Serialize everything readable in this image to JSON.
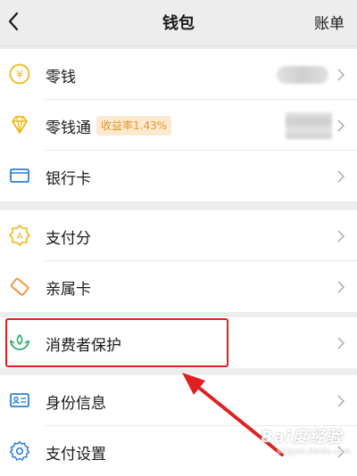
{
  "header": {
    "title": "钱包",
    "right_action": "账单"
  },
  "group1": {
    "items": [
      {
        "label": "零钱",
        "icon": "yen-coin-icon"
      },
      {
        "label": "零钱通",
        "badge": "收益率1.43%",
        "icon": "diamond-icon"
      },
      {
        "label": "银行卡",
        "icon": "bank-card-icon"
      }
    ]
  },
  "group2": {
    "items": [
      {
        "label": "支付分",
        "icon": "payment-score-icon"
      },
      {
        "label": "亲属卡",
        "icon": "family-card-icon"
      }
    ]
  },
  "group3": {
    "items": [
      {
        "label": "消费者保护",
        "icon": "consumer-protection-icon"
      }
    ]
  },
  "group4": {
    "items": [
      {
        "label": "身份信息",
        "icon": "id-card-icon"
      },
      {
        "label": "支付设置",
        "icon": "settings-gear-icon"
      }
    ]
  },
  "watermark": {
    "main": "Bai度经验",
    "sub": "jingyan.baidu.com"
  },
  "colors": {
    "accent_gold": "#f0b818",
    "accent_blue": "#2d7fd4",
    "accent_green": "#2aae67",
    "highlight_red": "#e02020",
    "badge_bg": "#fde9cf",
    "badge_text": "#e0992e"
  }
}
